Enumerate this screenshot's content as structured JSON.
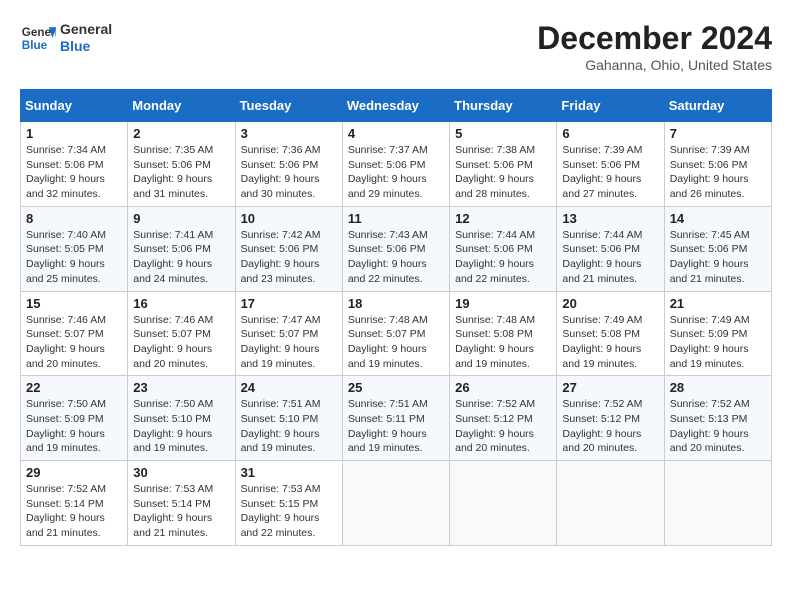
{
  "header": {
    "logo_general": "General",
    "logo_blue": "Blue",
    "month_title": "December 2024",
    "location": "Gahanna, Ohio, United States"
  },
  "days_of_week": [
    "Sunday",
    "Monday",
    "Tuesday",
    "Wednesday",
    "Thursday",
    "Friday",
    "Saturday"
  ],
  "weeks": [
    [
      {
        "day": "1",
        "sunrise": "7:34 AM",
        "sunset": "5:06 PM",
        "daylight": "9 hours and 32 minutes."
      },
      {
        "day": "2",
        "sunrise": "7:35 AM",
        "sunset": "5:06 PM",
        "daylight": "9 hours and 31 minutes."
      },
      {
        "day": "3",
        "sunrise": "7:36 AM",
        "sunset": "5:06 PM",
        "daylight": "9 hours and 30 minutes."
      },
      {
        "day": "4",
        "sunrise": "7:37 AM",
        "sunset": "5:06 PM",
        "daylight": "9 hours and 29 minutes."
      },
      {
        "day": "5",
        "sunrise": "7:38 AM",
        "sunset": "5:06 PM",
        "daylight": "9 hours and 28 minutes."
      },
      {
        "day": "6",
        "sunrise": "7:39 AM",
        "sunset": "5:06 PM",
        "daylight": "9 hours and 27 minutes."
      },
      {
        "day": "7",
        "sunrise": "7:39 AM",
        "sunset": "5:06 PM",
        "daylight": "9 hours and 26 minutes."
      }
    ],
    [
      {
        "day": "8",
        "sunrise": "7:40 AM",
        "sunset": "5:05 PM",
        "daylight": "9 hours and 25 minutes."
      },
      {
        "day": "9",
        "sunrise": "7:41 AM",
        "sunset": "5:06 PM",
        "daylight": "9 hours and 24 minutes."
      },
      {
        "day": "10",
        "sunrise": "7:42 AM",
        "sunset": "5:06 PM",
        "daylight": "9 hours and 23 minutes."
      },
      {
        "day": "11",
        "sunrise": "7:43 AM",
        "sunset": "5:06 PM",
        "daylight": "9 hours and 22 minutes."
      },
      {
        "day": "12",
        "sunrise": "7:44 AM",
        "sunset": "5:06 PM",
        "daylight": "9 hours and 22 minutes."
      },
      {
        "day": "13",
        "sunrise": "7:44 AM",
        "sunset": "5:06 PM",
        "daylight": "9 hours and 21 minutes."
      },
      {
        "day": "14",
        "sunrise": "7:45 AM",
        "sunset": "5:06 PM",
        "daylight": "9 hours and 21 minutes."
      }
    ],
    [
      {
        "day": "15",
        "sunrise": "7:46 AM",
        "sunset": "5:07 PM",
        "daylight": "9 hours and 20 minutes."
      },
      {
        "day": "16",
        "sunrise": "7:46 AM",
        "sunset": "5:07 PM",
        "daylight": "9 hours and 20 minutes."
      },
      {
        "day": "17",
        "sunrise": "7:47 AM",
        "sunset": "5:07 PM",
        "daylight": "9 hours and 19 minutes."
      },
      {
        "day": "18",
        "sunrise": "7:48 AM",
        "sunset": "5:07 PM",
        "daylight": "9 hours and 19 minutes."
      },
      {
        "day": "19",
        "sunrise": "7:48 AM",
        "sunset": "5:08 PM",
        "daylight": "9 hours and 19 minutes."
      },
      {
        "day": "20",
        "sunrise": "7:49 AM",
        "sunset": "5:08 PM",
        "daylight": "9 hours and 19 minutes."
      },
      {
        "day": "21",
        "sunrise": "7:49 AM",
        "sunset": "5:09 PM",
        "daylight": "9 hours and 19 minutes."
      }
    ],
    [
      {
        "day": "22",
        "sunrise": "7:50 AM",
        "sunset": "5:09 PM",
        "daylight": "9 hours and 19 minutes."
      },
      {
        "day": "23",
        "sunrise": "7:50 AM",
        "sunset": "5:10 PM",
        "daylight": "9 hours and 19 minutes."
      },
      {
        "day": "24",
        "sunrise": "7:51 AM",
        "sunset": "5:10 PM",
        "daylight": "9 hours and 19 minutes."
      },
      {
        "day": "25",
        "sunrise": "7:51 AM",
        "sunset": "5:11 PM",
        "daylight": "9 hours and 19 minutes."
      },
      {
        "day": "26",
        "sunrise": "7:52 AM",
        "sunset": "5:12 PM",
        "daylight": "9 hours and 20 minutes."
      },
      {
        "day": "27",
        "sunrise": "7:52 AM",
        "sunset": "5:12 PM",
        "daylight": "9 hours and 20 minutes."
      },
      {
        "day": "28",
        "sunrise": "7:52 AM",
        "sunset": "5:13 PM",
        "daylight": "9 hours and 20 minutes."
      }
    ],
    [
      {
        "day": "29",
        "sunrise": "7:52 AM",
        "sunset": "5:14 PM",
        "daylight": "9 hours and 21 minutes."
      },
      {
        "day": "30",
        "sunrise": "7:53 AM",
        "sunset": "5:14 PM",
        "daylight": "9 hours and 21 minutes."
      },
      {
        "day": "31",
        "sunrise": "7:53 AM",
        "sunset": "5:15 PM",
        "daylight": "9 hours and 22 minutes."
      },
      null,
      null,
      null,
      null
    ]
  ],
  "labels": {
    "sunrise": "Sunrise:",
    "sunset": "Sunset:",
    "daylight": "Daylight: "
  }
}
